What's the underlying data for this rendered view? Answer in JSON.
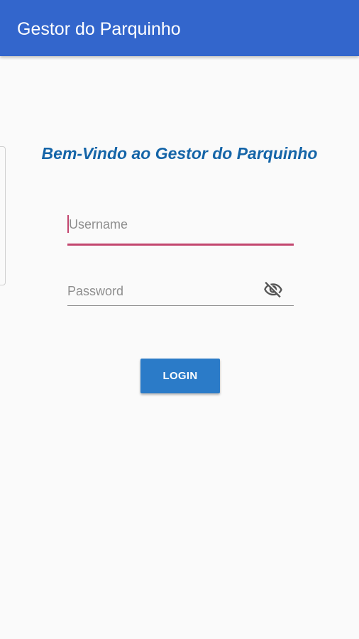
{
  "app_bar": {
    "title": "Gestor do Parquinho"
  },
  "welcome": {
    "heading": "Bem-Vindo ao Gestor do Parquinho"
  },
  "login_form": {
    "username": {
      "placeholder": "Username",
      "value": ""
    },
    "password": {
      "placeholder": "Password",
      "value": "",
      "visibility_icon": "eye-off-icon"
    },
    "login_button_label": "LOGIN"
  },
  "colors": {
    "app_bar": "#3366cc",
    "heading": "#1565a8",
    "focused_field": "#c2456e",
    "button": "#2b7bc8",
    "background": "#fafafa"
  }
}
